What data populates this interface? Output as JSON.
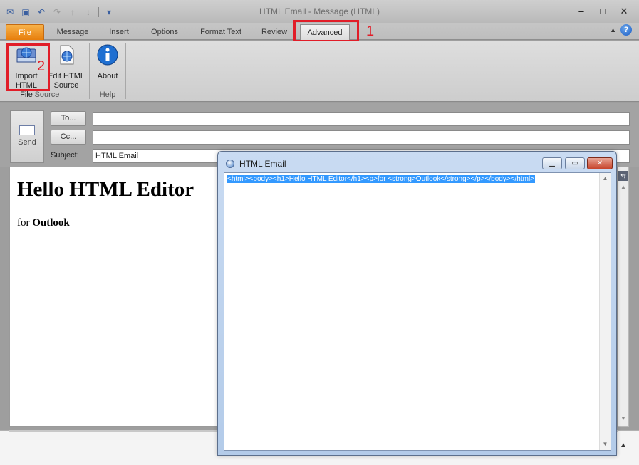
{
  "window": {
    "title": "HTML Email  -  Message (HTML)",
    "controls": {
      "minimize": "‒",
      "maximize": "□",
      "close": "✕"
    }
  },
  "quick_access": [
    "save-icon",
    "undo-icon",
    "redo-icon",
    "up-icon",
    "down-icon",
    "customize-icon"
  ],
  "ribbon_tabs": [
    "File",
    "Message",
    "Insert",
    "Options",
    "Format Text",
    "Review",
    "Advanced"
  ],
  "annotations": {
    "step1": "1",
    "step2": "2"
  },
  "ribbon": {
    "import_label_1": "Import",
    "import_label_2": "HTML File",
    "edit_label_1": "Edit HTML",
    "edit_label_2": "Source",
    "about_label": "About",
    "group_source": "Source",
    "group_help": "Help"
  },
  "compose": {
    "send_label": "Send",
    "to_button": "To...",
    "cc_button": "Cc...",
    "subject_label": "Subject:",
    "to_value": "",
    "cc_value": "",
    "subject_value": "HTML Email"
  },
  "message": {
    "heading": "Hello HTML Editor",
    "para_prefix": "for ",
    "para_bold": "Outlook"
  },
  "dialog": {
    "title": "HTML Email",
    "source_code": "<html><body><h1>Hello HTML Editor</h1><p>for <strong>Outlook</strong></p></body></html>"
  },
  "colors": {
    "file_tab": "#e77e0c",
    "highlight": "#e11d28",
    "selection": "#3399ff"
  }
}
